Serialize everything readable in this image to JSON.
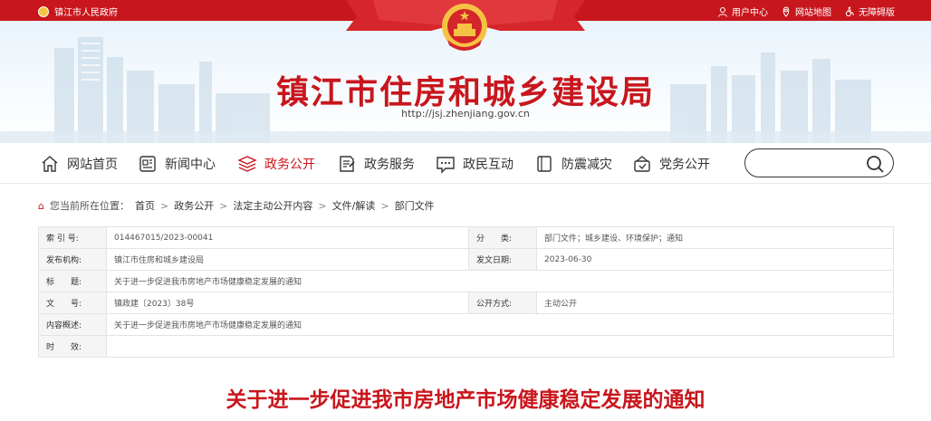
{
  "topbar": {
    "gov_link": "镇江市人民政府",
    "user_center": "用户中心",
    "site_map": "网站地图",
    "accessibility": "无障碍版"
  },
  "banner": {
    "title": "镇江市住房和城乡建设局",
    "url": "http://jsj.zhenjiang.gov.cn"
  },
  "nav": {
    "items": [
      {
        "label": "网站首页",
        "icon": "home-icon"
      },
      {
        "label": "新闻中心",
        "icon": "news-icon"
      },
      {
        "label": "政务公开",
        "icon": "layers-icon"
      },
      {
        "label": "政务服务",
        "icon": "service-icon"
      },
      {
        "label": "政民互动",
        "icon": "chat-icon"
      },
      {
        "label": "防震减灾",
        "icon": "shield-icon"
      },
      {
        "label": "党务公开",
        "icon": "party-icon"
      }
    ],
    "active_index": 2,
    "search_placeholder": ""
  },
  "breadcrumb": {
    "prefix": "您当前所在位置：",
    "items": [
      "首页",
      "政务公开",
      "法定主动公开内容",
      "文件/解读",
      "部门文件"
    ]
  },
  "meta": {
    "index_label": "索 引 号:",
    "index_value": "014467015/2023-00041",
    "category_label": "分　　类:",
    "category_value": "部门文件；城乡建设、环境保护；通知",
    "publisher_label": "发布机构:",
    "publisher_value": "镇江市住房和城乡建设局",
    "date_label": "发文日期:",
    "date_value": "2023-06-30",
    "title_label": "标　　题:",
    "title_value": "关于进一步促进我市房地产市场健康稳定发展的通知",
    "docno_label": "文　　号:",
    "docno_value": "镇政建〔2023〕38号",
    "mode_label": "公开方式:",
    "mode_value": "主动公开",
    "summary_label": "内容概述:",
    "summary_value": "关于进一步促进我市房地产市场健康稳定发展的通知",
    "validity_label": "时　　效:",
    "validity_value": ""
  },
  "document": {
    "title": "关于进一步促进我市房地产市场健康稳定发展的通知"
  },
  "colors": {
    "brand_red": "#c8161d",
    "gold": "#f6c244"
  }
}
